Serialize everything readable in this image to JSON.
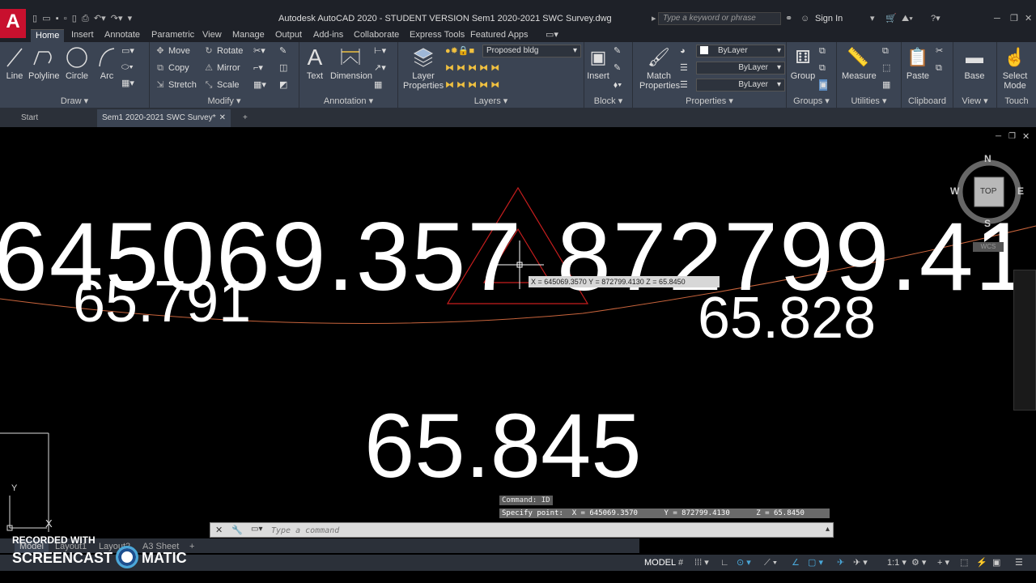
{
  "window": {
    "title": "Autodesk AutoCAD 2020 - STUDENT VERSION    Sem1 2020-2021 SWC Survey.dwg",
    "search_placeholder": "Type a keyword or phrase",
    "sign_in": "Sign In",
    "logo": "A"
  },
  "menu_tabs": [
    "Home",
    "Insert",
    "Annotate",
    "Parametric",
    "View",
    "Manage",
    "Output",
    "Add-ins",
    "Collaborate",
    "Express Tools",
    "Featured Apps"
  ],
  "ribbon": {
    "draw": {
      "title": "Draw",
      "line": "Line",
      "polyline": "Polyline",
      "circle": "Circle",
      "arc": "Arc"
    },
    "modify": {
      "title": "Modify",
      "move": "Move",
      "rotate": "Rotate",
      "copy": "Copy",
      "mirror": "Mirror",
      "stretch": "Stretch",
      "scale": "Scale"
    },
    "annotation": {
      "title": "Annotation",
      "text": "Text",
      "dimension": "Dimension"
    },
    "layers": {
      "title": "Layers",
      "layer_properties_1": "Layer",
      "layer_properties_2": "Properties",
      "current_layer": "Proposed bldg"
    },
    "block": {
      "title": "Block",
      "insert": "Insert"
    },
    "properties": {
      "title": "Properties",
      "match_1": "Match",
      "match_2": "Properties",
      "color": "ByLayer",
      "linetype": "ByLayer",
      "lineweight": "ByLayer"
    },
    "groups": {
      "title": "Groups",
      "group": "Group"
    },
    "utilities": {
      "title": "Utilities",
      "measure": "Measure"
    },
    "clipboard": {
      "title": "Clipboard",
      "paste": "Paste"
    },
    "view": {
      "title": "View",
      "base": "Base"
    },
    "touch": {
      "title": "Touch",
      "select_1": "Select",
      "select_2": "Mode"
    }
  },
  "file_tabs": {
    "start": "Start",
    "current": "Sem1 2020-2021 SWC Survey*"
  },
  "drawing": {
    "coord_x": "645069.357",
    "coord_y": "872799.41",
    "elev_left": "65.791",
    "elev_right": "65.828",
    "elev_center": "65.845",
    "tooltip": "X = 645069.3570     Y = 872799.4130     Z = 65.8450"
  },
  "viewcube": {
    "n": "N",
    "s": "S",
    "e": "E",
    "w": "W",
    "top": "TOP",
    "wcs": "WCS"
  },
  "ucs": {
    "y": "Y",
    "x": "X"
  },
  "command": {
    "history_1": "Command: ID",
    "history_2": "Specify point:  X = 645069.3570      Y = 872799.4130      Z = 65.8450",
    "placeholder": "Type a command"
  },
  "layout_tabs": [
    "Model",
    "Layout1",
    "Layout2",
    "A3 Sheet"
  ],
  "status": {
    "model": "MODEL",
    "scale": "1:1"
  },
  "watermark": {
    "line1": "RECORDED WITH",
    "line2a": "SCREENCAST",
    "line2b": "MATIC"
  }
}
